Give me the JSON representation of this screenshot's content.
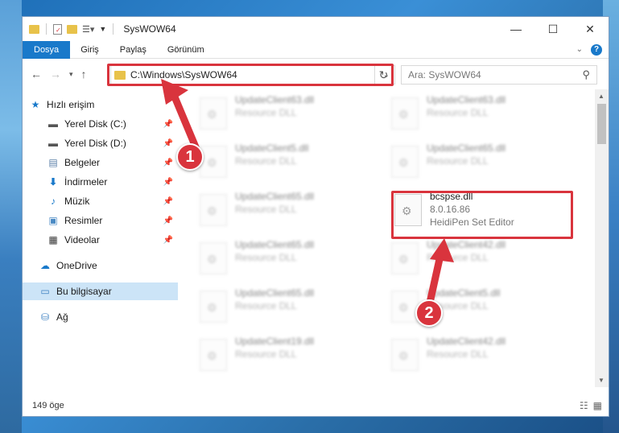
{
  "window": {
    "title": "SysWOW64",
    "controls": {
      "minimize": "—",
      "maximize": "☐",
      "close": "✕"
    }
  },
  "ribbon": {
    "tabs": [
      "Dosya",
      "Giriş",
      "Paylaş",
      "Görünüm"
    ]
  },
  "address": {
    "path": "C:\\Windows\\SysWOW64"
  },
  "search": {
    "placeholder": "Ara: SysWOW64"
  },
  "sidebar": {
    "items": [
      {
        "label": "Hızlı erişim",
        "icon": "star-icon"
      },
      {
        "label": "Yerel Disk (C:)",
        "icon": "drive-icon",
        "pinned": true
      },
      {
        "label": "Yerel Disk (D:)",
        "icon": "drive-icon",
        "pinned": true
      },
      {
        "label": "Belgeler",
        "icon": "documents-icon",
        "pinned": true
      },
      {
        "label": "İndirmeler",
        "icon": "download-icon",
        "pinned": true
      },
      {
        "label": "Müzik",
        "icon": "music-icon",
        "pinned": true
      },
      {
        "label": "Resimler",
        "icon": "pictures-icon",
        "pinned": true
      },
      {
        "label": "Videolar",
        "icon": "videos-icon",
        "pinned": true
      },
      {
        "label": "OneDrive",
        "icon": "cloud-icon"
      },
      {
        "label": "Bu bilgisayar",
        "icon": "computer-icon",
        "selected": true
      },
      {
        "label": "Ağ",
        "icon": "network-icon"
      }
    ]
  },
  "files": {
    "left": [
      {
        "name": "UpdateClient63.dll",
        "sub": "Resource DLL"
      },
      {
        "name": "UpdateClient5.dll",
        "sub": "Resource DLL"
      },
      {
        "name": "UpdateClient65.dll",
        "sub": "Resource DLL"
      },
      {
        "name": "UpdateClient65.dll",
        "sub": "Resource DLL"
      },
      {
        "name": "UpdateClient65.dll",
        "sub": "Resource DLL"
      },
      {
        "name": "UpdateClient19.dll",
        "sub": "Resource DLL"
      }
    ],
    "right": [
      {
        "name": "UpdateClient63.dll",
        "sub": "Resource DLL"
      },
      {
        "name": "UpdateClient65.dll",
        "sub": "Resource DLL"
      },
      {
        "name": "bcspse.dll",
        "version": "8.0.16.86",
        "sub": "HeidiPen Set Editor"
      },
      {
        "name": "UpdateClient42.dll",
        "sub": "Resource DLL"
      },
      {
        "name": "UpdateClient5.dll",
        "sub": "Resource DLL"
      },
      {
        "name": "UpdateClient42.dll",
        "sub": "Resource DLL"
      }
    ]
  },
  "status": {
    "count": "149 öge"
  },
  "annotations": {
    "marker1": "1",
    "marker2": "2",
    "color": "#d9343d"
  }
}
